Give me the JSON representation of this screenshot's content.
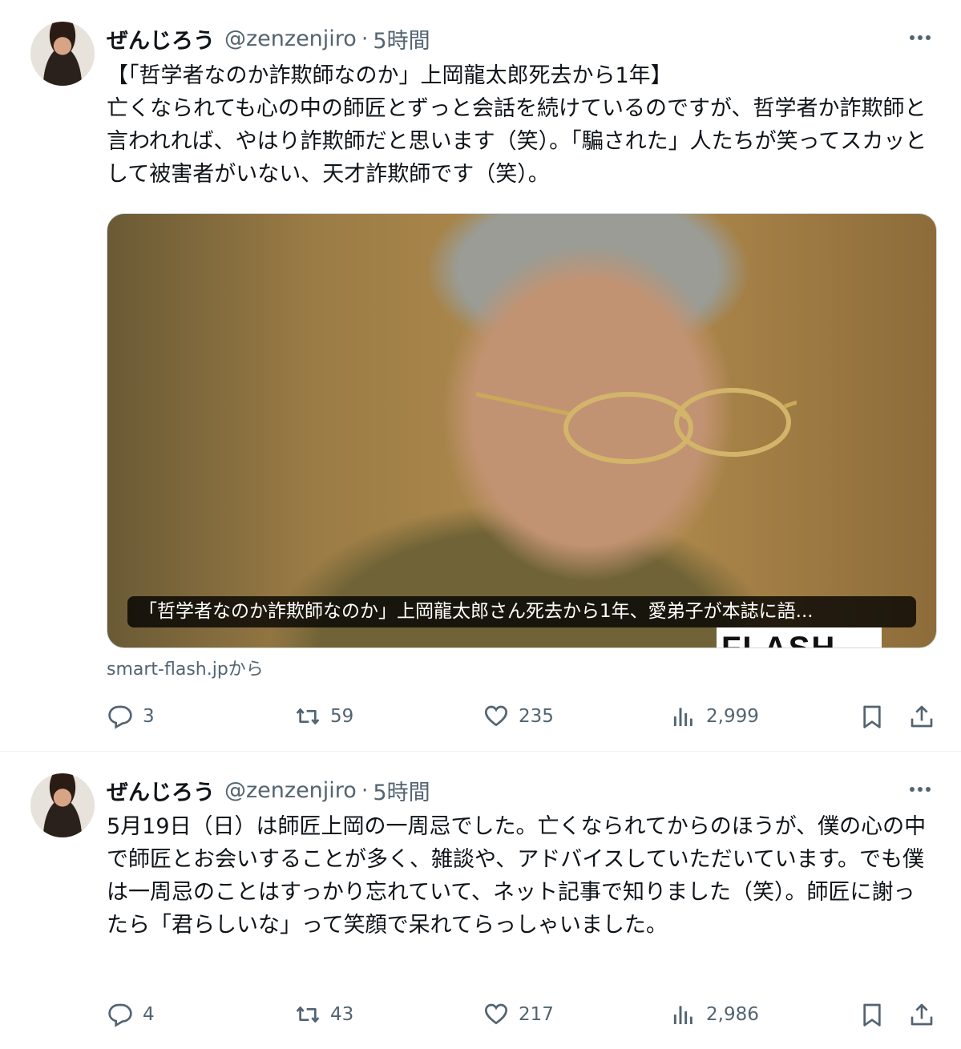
{
  "tweets": [
    {
      "display_name": "ぜんじろう",
      "handle": "@zenzenjiro",
      "separator": "·",
      "time": "5時間",
      "text": "【「哲学者なのか詐欺師なのか」上岡龍太郎死去から1年】\n亡くなられても心の中の師匠とずっと会話を続けているのですが、哲学者か詐欺師と言われれば、やはり詐欺師だと思います（笑）。「騙された」人たちが笑ってスカッとして被害者がいない、天才詐欺師です（笑）。",
      "card": {
        "caption": "「哲学者なのか詐欺師なのか」上岡龍太郎さん死去から1年、愛弟子が本誌に語...",
        "watermark": "FLASH",
        "source": "smart-flash.jpから"
      },
      "stats": {
        "replies": "3",
        "reposts": "59",
        "likes": "235",
        "views": "2,999"
      }
    },
    {
      "display_name": "ぜんじろう",
      "handle": "@zenzenjiro",
      "separator": "·",
      "time": "5時間",
      "text": "5月19日（日）は師匠上岡の一周忌でした。亡くなられてからのほうが、僕の心の中で師匠とお会いすることが多く、雑談や、アドバイスしていただいています。でも僕は一周忌のことはすっかり忘れていて、ネット記事で知りました（笑）。師匠に謝ったら「君らしいな」って笑顔で呆れてらっしゃいました。",
      "stats": {
        "replies": "4",
        "reposts": "43",
        "likes": "217",
        "views": "2,986"
      }
    }
  ],
  "icons": [
    "more-icon",
    "reply-icon",
    "repost-icon",
    "like-icon",
    "views-icon",
    "bookmark-icon",
    "share-icon"
  ],
  "colors": {
    "text": "#0f1419",
    "secondary": "#536471",
    "border": "#cfd9de",
    "divider": "#eff3f4"
  }
}
